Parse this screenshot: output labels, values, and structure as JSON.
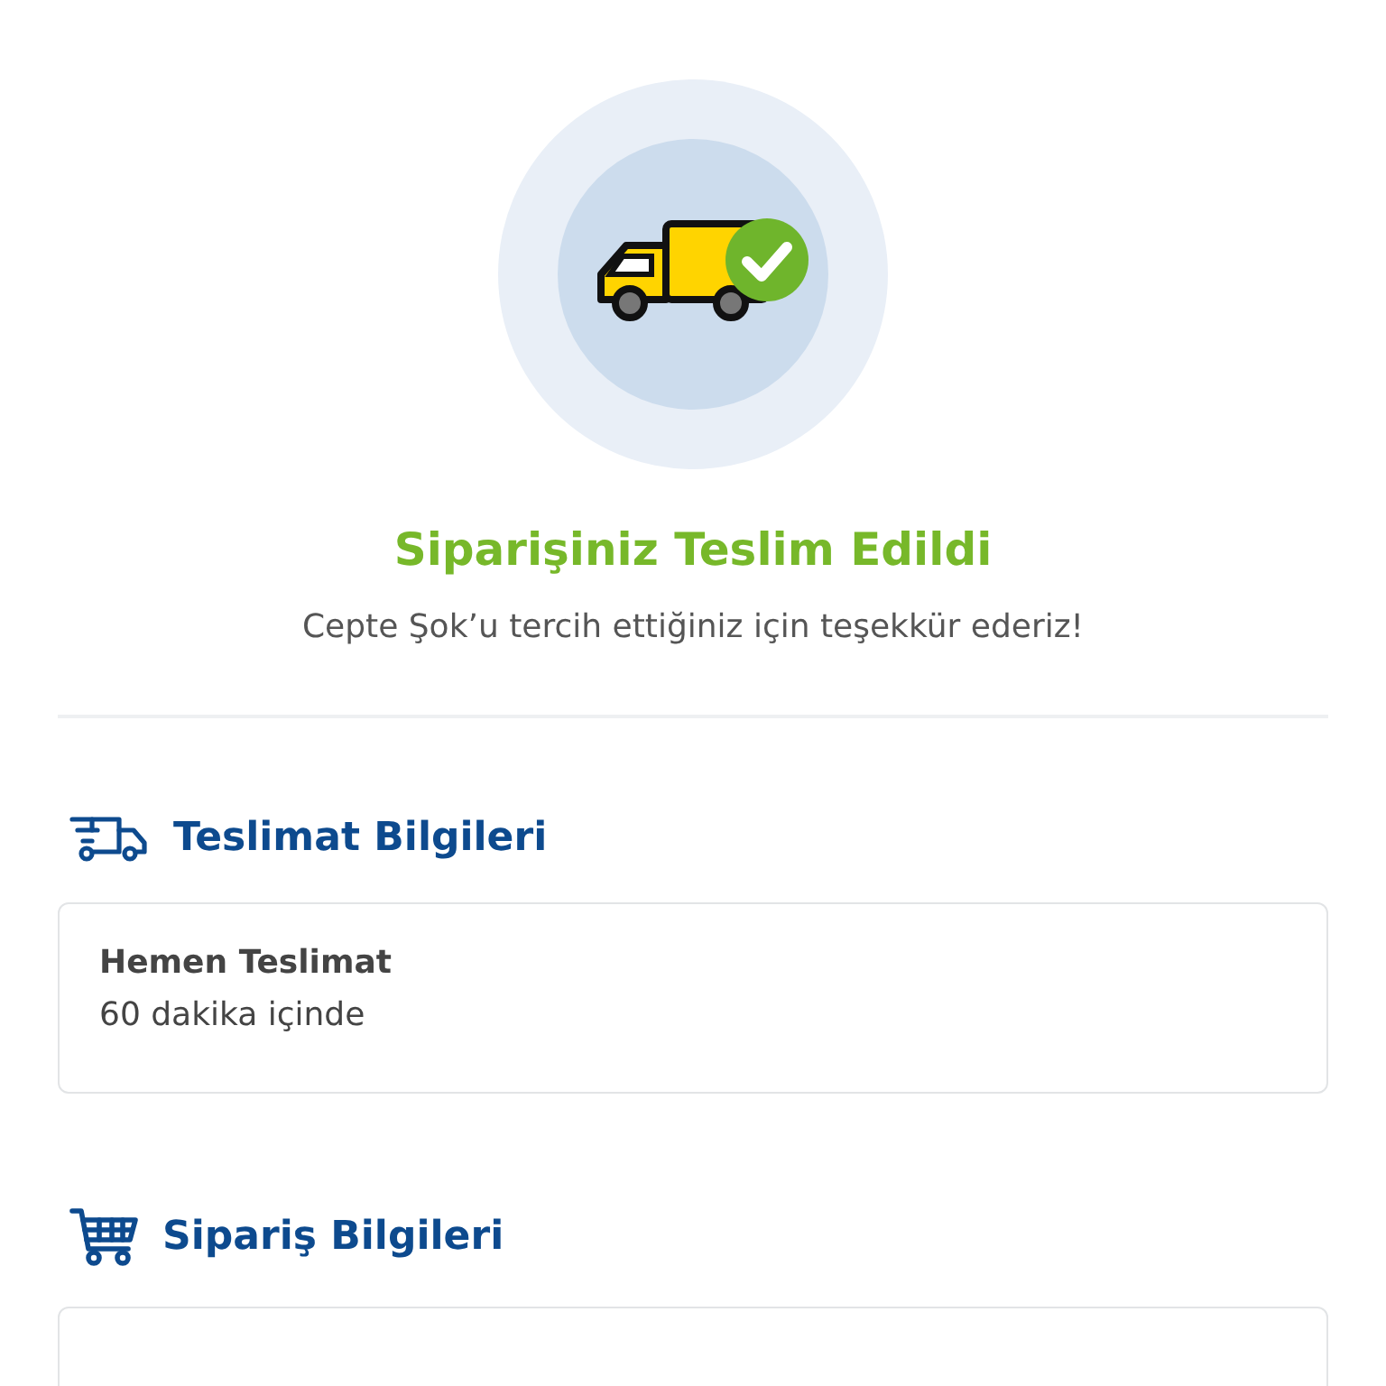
{
  "status": {
    "title": "Siparişiniz Teslim Edildi",
    "message": "Cepte Şok’u tercih ettiğiniz için teşekkür ederiz!"
  },
  "sections": [
    {
      "kind": "delivery",
      "title": "Teslimat Bilgileri",
      "card": {
        "heading": "Hemen Teslimat",
        "text": "60 dakika içinde"
      }
    },
    {
      "kind": "order",
      "title": "Sipariş Bilgileri"
    }
  ]
}
